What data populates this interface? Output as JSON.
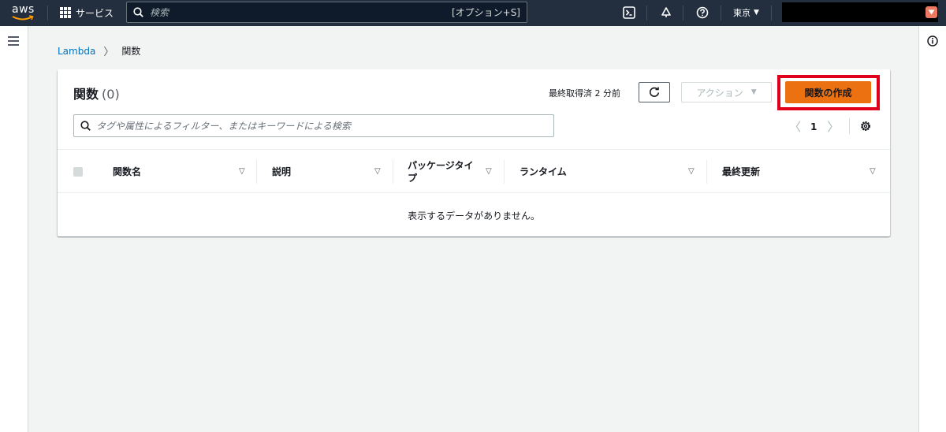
{
  "topnav": {
    "logo_text": "aws",
    "services_label": "サービス",
    "search_placeholder": "検索",
    "search_shortcut": "[オプション+S]",
    "region_label": "東京",
    "icons": [
      "cloudshell-icon",
      "bell-icon",
      "help-icon"
    ],
    "account_badge_color": "#ec7a63"
  },
  "breadcrumb": {
    "parent": "Lambda",
    "current": "関数"
  },
  "panel": {
    "title": "関数",
    "count": "(0)",
    "last_fetched": "最終取得済 2 分前",
    "actions_label": "アクション",
    "create_label": "関数の作成",
    "highlight_color": "#e0001b",
    "filter_placeholder": "タグや属性によるフィルター、またはキーワードによる検索",
    "pager": {
      "prev": "〈",
      "page": "1",
      "next": "〉"
    },
    "columns": [
      "関数名",
      "説明",
      "パッケージタイプ",
      "ランタイム",
      "最終更新"
    ],
    "empty_message": "表示するデータがありません。"
  },
  "colors": {
    "topnav_bg": "#232f3e",
    "primary_button": "#ec7211",
    "link": "#0073bb"
  }
}
